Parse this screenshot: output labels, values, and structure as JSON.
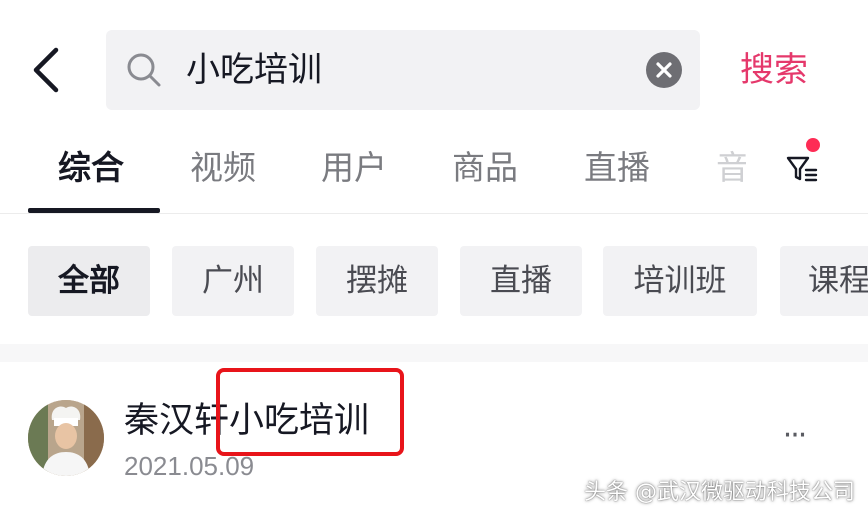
{
  "header": {
    "back_icon": "chevron-left-icon",
    "search_icon": "search-icon",
    "query": "小吃培训",
    "clear_icon": "close-circle-icon",
    "search_label": "搜索",
    "accent": "#e5386b"
  },
  "tabs": {
    "items": [
      {
        "label": "综合",
        "active": true
      },
      {
        "label": "视频"
      },
      {
        "label": "用户"
      },
      {
        "label": "商品"
      },
      {
        "label": "直播"
      },
      {
        "label": "音"
      }
    ],
    "filter_icon": "filter-icon",
    "notification_dot_color": "#fe2c55"
  },
  "chips": [
    {
      "label": "全部",
      "selected": true
    },
    {
      "label": "广州"
    },
    {
      "label": "摆摊"
    },
    {
      "label": "直播"
    },
    {
      "label": "培训班"
    },
    {
      "label": "课程"
    }
  ],
  "result": {
    "avatar_icon": "chef-avatar",
    "title_prefix": "秦汉轩",
    "title_highlight": "小吃培训",
    "date": "2021.05.09",
    "more_icon": "more-dots-icon",
    "more_label": "···"
  },
  "watermark": "头条 @武汉微驱动科技公司"
}
